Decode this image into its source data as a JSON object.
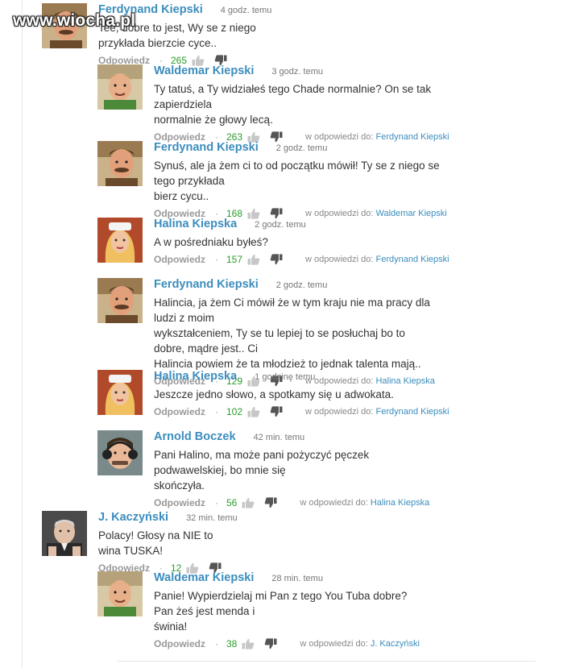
{
  "watermark": "www.wiocha.pl",
  "reply_label": "Odpowiedz",
  "reply_to_label": "w odpowiedzi do:",
  "separator": "·",
  "comments": [
    {
      "author": "Ferdynand Kiepski",
      "time": "4 godz. temu",
      "lines": [
        "Tee, dobre to jest, Wy se z niego przykłada bierzcie cyce.."
      ],
      "votes": "265",
      "reply_to": "",
      "avatar": "ferdynand"
    },
    {
      "author": "Waldemar Kiepski",
      "time": "3 godz. temu",
      "lines": [
        "Ty tatuś, a Ty widziałeś tego Chade normalnie? On se tak zapierdziela",
        "normalnie że głowy lecą."
      ],
      "votes": "263",
      "reply_to": "Ferdynand Kiepski",
      "avatar": "waldemar"
    },
    {
      "author": "Ferdynand Kiepski",
      "time": "2 godz. temu",
      "lines": [
        "Synuś, ale ja żem ci to od początku mówił! Ty se z niego se tego przykłada",
        "bierz cycu.."
      ],
      "votes": "168",
      "reply_to": "Waldemar Kiepski",
      "avatar": "ferdynand"
    },
    {
      "author": "Halina Kiepska",
      "time": "2 godz. temu",
      "lines": [
        "A w pośredniaku byłeś?"
      ],
      "votes": "157",
      "reply_to": "Ferdynand Kiepski",
      "avatar": "halina"
    },
    {
      "author": "Ferdynand Kiepski",
      "time": "2 godz. temu",
      "lines": [
        "Halincia, ja żem Ci mówił że w tym kraju nie ma pracy dla ludzi z moim",
        "wykształceniem, Ty se tu lepiej to se posłuchaj bo to dobre, mądre jest.. Ci",
        "Halincia powiem że ta młodzież to jednak talenta mają.."
      ],
      "votes": "129",
      "reply_to": "Halina Kiepska",
      "avatar": "ferdynand"
    },
    {
      "author": "Halina Kiepska",
      "time": "1 godzinę temu",
      "lines": [
        "Jeszcze jedno słowo, a spotkamy się u adwokata."
      ],
      "votes": "102",
      "reply_to": "Ferdynand Kiepski",
      "avatar": "halina"
    },
    {
      "author": "Arnold Boczek",
      "time": "42 min. temu",
      "lines": [
        "Pani Halino, ma może pani pożyczyć pęczek podwawelskiej, bo mnie się",
        "skończyła."
      ],
      "votes": "56",
      "reply_to": "Halina Kiepska",
      "avatar": "arnold"
    },
    {
      "author": "J. Kaczyński",
      "time": "32 min. temu",
      "lines": [
        "Polacy! Głosy na NIE to wina TUSKA!"
      ],
      "votes": "12",
      "reply_to": "",
      "avatar": "kaczynski"
    },
    {
      "author": "Waldemar Kiepski",
      "time": "28 min. temu",
      "lines": [
        "Panie! Wypierdzielaj mi Pan z tego You Tuba dobre? Pan żeś jest menda i",
        "świnia!"
      ],
      "votes": "38",
      "reply_to": "J. Kaczyński",
      "avatar": "waldemar"
    }
  ]
}
